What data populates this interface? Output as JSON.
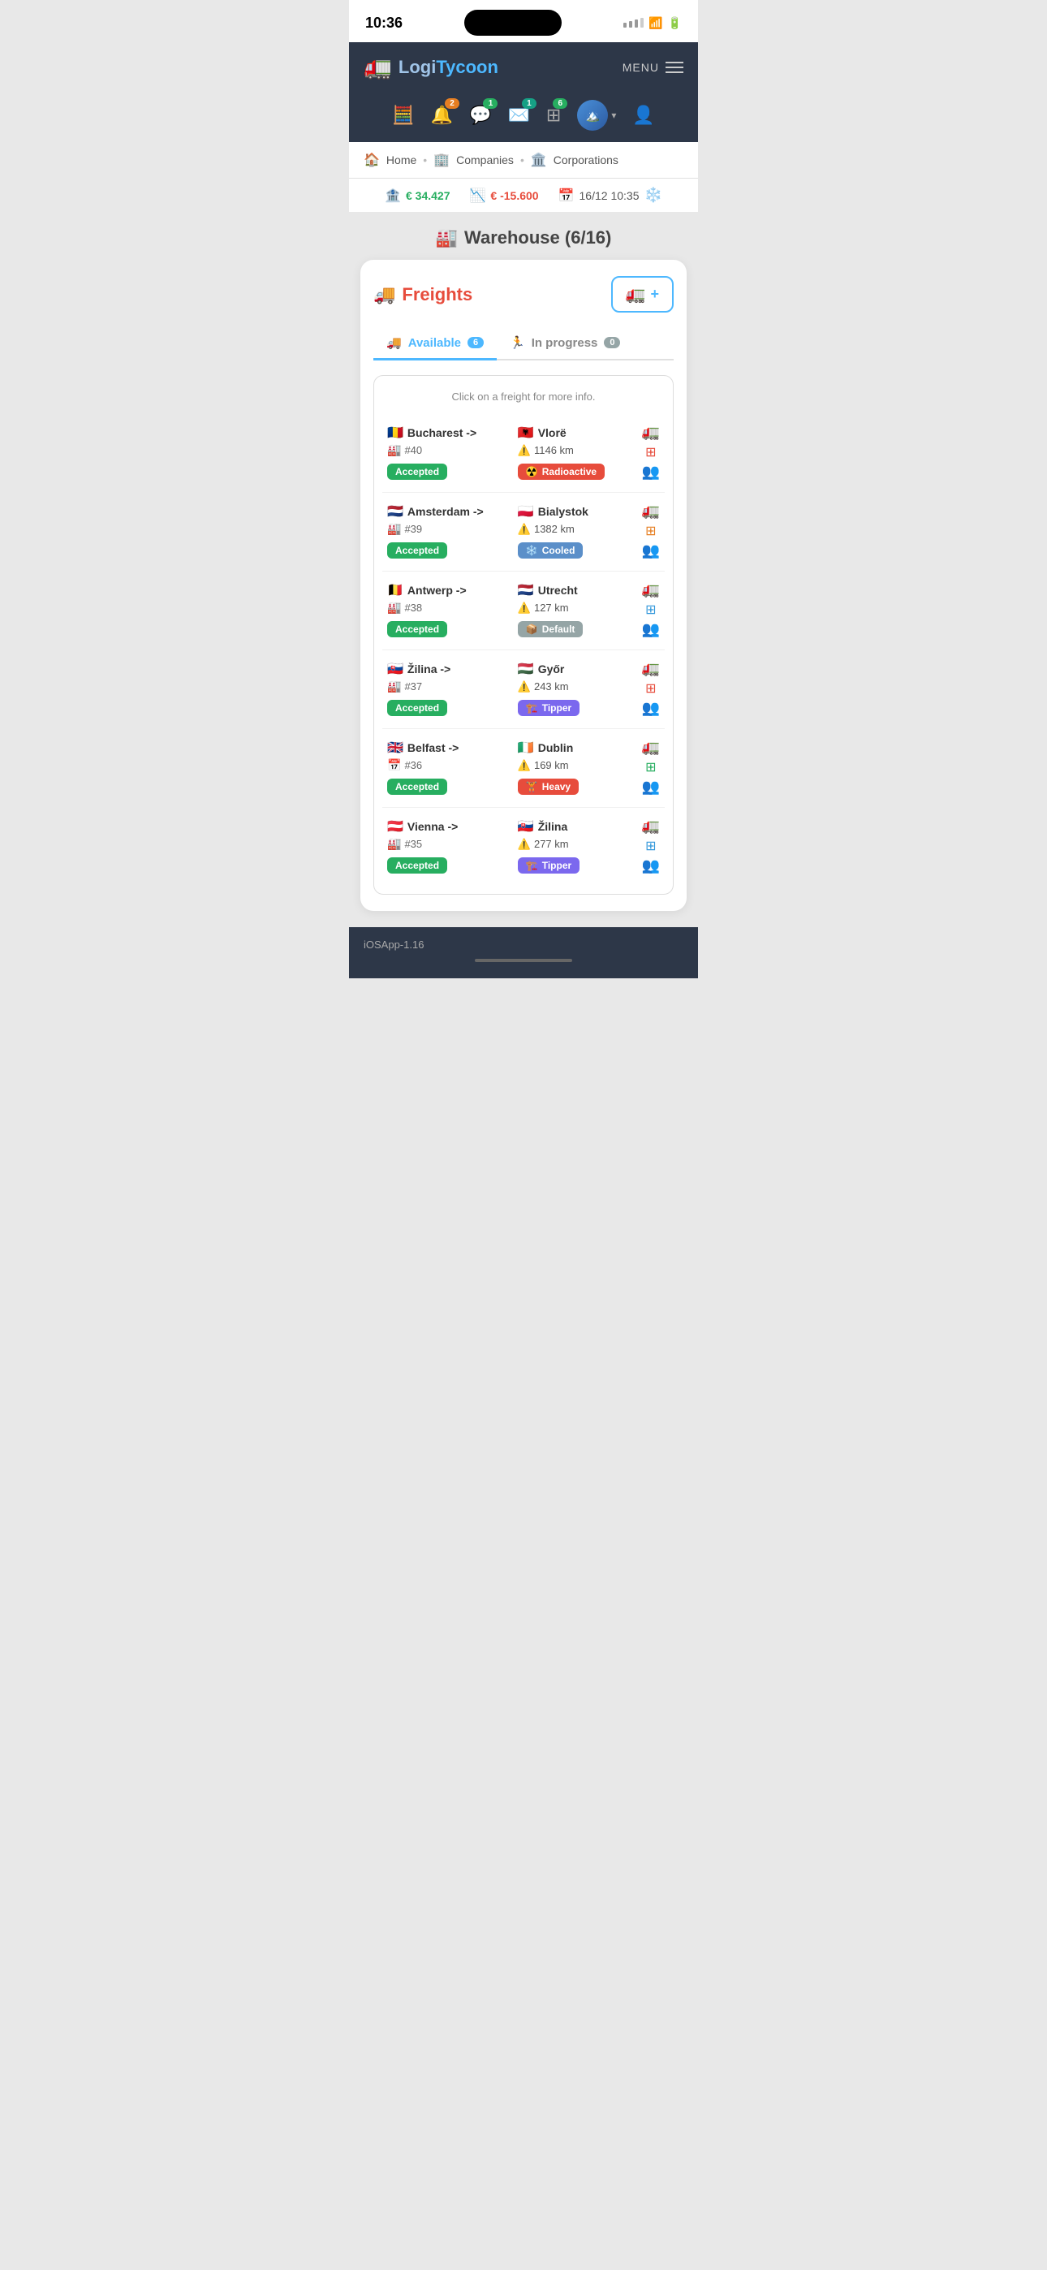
{
  "statusBar": {
    "time": "10:36",
    "battery": "🔋",
    "wifi": "📶"
  },
  "header": {
    "logoLogi": "Logi",
    "logoTycoon": "Tycoon",
    "menuLabel": "MENU"
  },
  "nav": {
    "items": [
      {
        "id": "calculator",
        "icon": "🧮",
        "badge": null
      },
      {
        "id": "bell",
        "icon": "🔔",
        "badge": "2",
        "badgeColor": "badge-orange"
      },
      {
        "id": "chat",
        "icon": "💬",
        "badge": "1",
        "badgeColor": "badge-green"
      },
      {
        "id": "mail",
        "icon": "✉️",
        "badge": "1",
        "badgeColor": "badge-teal"
      },
      {
        "id": "grid",
        "icon": "⊞",
        "badge": "6",
        "badgeColor": "badge-green"
      }
    ]
  },
  "breadcrumb": {
    "home": "Home",
    "companies": "Companies",
    "corporations": "Corporations"
  },
  "finance": {
    "balance": "€ 34.427",
    "change": "€ -15.600",
    "date": "16/12 10:35"
  },
  "pageTitle": "Warehouse (6/16)",
  "freightsSection": {
    "title": "Freights",
    "addBtnIcon": "🚛+",
    "hintText": "Click on a freight for more info.",
    "tabs": [
      {
        "label": "Available",
        "count": "6",
        "active": true
      },
      {
        "label": "In progress",
        "count": "0",
        "active": false
      }
    ]
  },
  "freights": [
    {
      "from": "Bucharest ->",
      "fromFlag": "🇷🇴",
      "to": "Vlorë",
      "toFlag": "🇦🇱",
      "id": "#40",
      "distance": "1146 km",
      "status": "Accepted",
      "type": "Radioactive",
      "typeClass": "type-radioactive",
      "typeIcon": "☢️",
      "truckColor": "truck-red",
      "truckIcon": "🚛",
      "gridIcon": "🔲",
      "peopleIcon": "👥",
      "rowColorClass": "row-icons-red"
    },
    {
      "from": "Amsterdam ->",
      "fromFlag": "🇳🇱",
      "to": "Bialystok",
      "toFlag": "🇵🇱",
      "id": "#39",
      "distance": "1382 km",
      "status": "Accepted",
      "type": "Cooled",
      "typeClass": "type-cooled",
      "typeIcon": "❄️",
      "truckColor": "truck-orange",
      "truckIcon": "🚛",
      "gridIcon": "🔲",
      "peopleIcon": "👥",
      "rowColorClass": "row-icons-orange"
    },
    {
      "from": "Antwerp ->",
      "fromFlag": "🇧🇪",
      "to": "Utrecht",
      "toFlag": "🇳🇱",
      "id": "#38",
      "distance": "127 km",
      "status": "Accepted",
      "type": "Default",
      "typeClass": "type-default",
      "typeIcon": "📦",
      "truckColor": "truck-blue",
      "truckIcon": "🚛",
      "gridIcon": "🔲",
      "peopleIcon": "👥",
      "rowColorClass": "row-icons-blue"
    },
    {
      "from": "Žilina ->",
      "fromFlag": "🇸🇰",
      "to": "Győr",
      "toFlag": "🇭🇺",
      "id": "#37",
      "distance": "243 km",
      "status": "Accepted",
      "type": "Tipper",
      "typeClass": "type-tipper",
      "typeIcon": "🏗️",
      "truckColor": "truck-red",
      "truckIcon": "🚛",
      "gridIcon": "🔲",
      "peopleIcon": "👥",
      "rowColorClass": "row-icons-red"
    },
    {
      "from": "Belfast ->",
      "fromFlag": "🇬🇧",
      "to": "Dublin",
      "toFlag": "🇮🇪",
      "id": "#36",
      "distance": "169 km",
      "status": "Accepted",
      "type": "Heavy",
      "typeClass": "type-heavy",
      "typeIcon": "🏋️",
      "truckColor": "truck-green",
      "truckIcon": "🚛",
      "gridIcon": "🔲",
      "peopleIcon": "👥",
      "rowColorClass": "row-icons-green"
    },
    {
      "from": "Vienna ->",
      "fromFlag": "🇦🇹",
      "to": "Žilina",
      "toFlag": "🇸🇰",
      "id": "#35",
      "distance": "277 km",
      "status": "Accepted",
      "type": "Tipper",
      "typeClass": "type-tipper",
      "typeIcon": "🏗️",
      "truckColor": "truck-blue",
      "truckIcon": "🚛",
      "gridIcon": "🔲",
      "peopleIcon": "👥",
      "rowColorClass": "row-icons-blue"
    }
  ],
  "footer": {
    "version": "iOSApp-1.16"
  }
}
